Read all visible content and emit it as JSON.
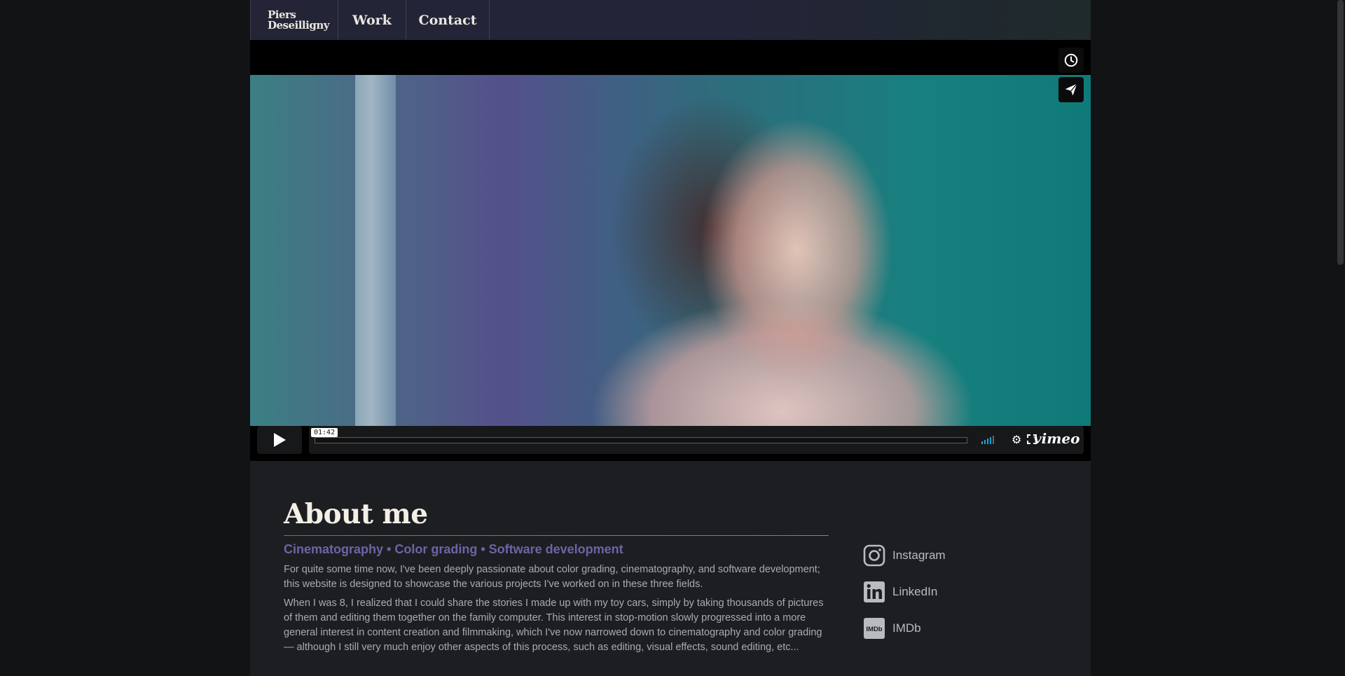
{
  "nav": {
    "logo_line1": "Piers",
    "logo_line2": "Deseilligny",
    "work_label": "Work",
    "contact_label": "Contact"
  },
  "video": {
    "timestamp_tooltip": "01:42",
    "progress_fraction": 0.0,
    "volume_level_bars": 4,
    "volume_total_bars": 5,
    "provider_logo": "vimeo",
    "icons": {
      "watch_later": "clock-icon",
      "share": "paper-plane-icon",
      "play": "play-icon",
      "settings": "gear-icon",
      "fullscreen": "fullscreen-icon"
    }
  },
  "about": {
    "title": "About me",
    "subtitle": "Cinematography • Color grading • Software development",
    "paragraph1": "For quite some time now, I've been deeply passionate about color grading, cinematography, and software development; this website is designed to showcase the various projects I've worked on in these three fields.",
    "paragraph2": "When I was 8, I realized that I could share the stories I made up with my toy cars, simply by taking thousands of pictures of them and editing them together on the family computer. This interest in stop-motion slowly progressed into a more general interest in content creation and filmmaking, which I've now narrowed down to cinematography and color grading — although I still very much enjoy other aspects of this process, such as editing, visual effects, sound editing, etc..."
  },
  "social": [
    {
      "label": "Instagram",
      "icon": "instagram-icon"
    },
    {
      "label": "LinkedIn",
      "icon": "linkedin-icon"
    },
    {
      "label": "IMDb",
      "icon": "imdb-icon"
    }
  ],
  "colors": {
    "accent_purple": "#6c64a8",
    "page_bg": "#1d1e21",
    "outer_bg": "#121314"
  }
}
